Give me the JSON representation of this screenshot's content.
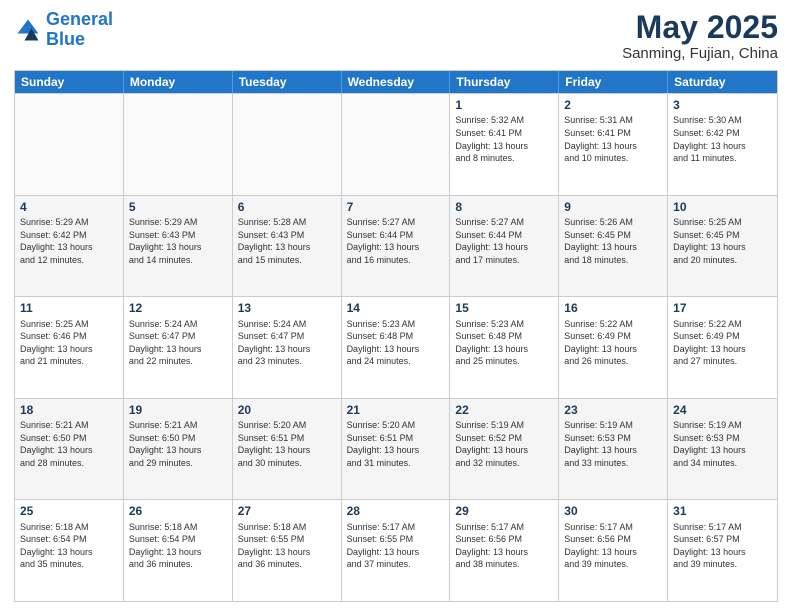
{
  "header": {
    "logo_line1": "General",
    "logo_line2": "Blue",
    "month": "May 2025",
    "location": "Sanming, Fujian, China"
  },
  "weekdays": [
    "Sunday",
    "Monday",
    "Tuesday",
    "Wednesday",
    "Thursday",
    "Friday",
    "Saturday"
  ],
  "rows": [
    [
      {
        "day": "",
        "info": "",
        "empty": true
      },
      {
        "day": "",
        "info": "",
        "empty": true
      },
      {
        "day": "",
        "info": "",
        "empty": true
      },
      {
        "day": "",
        "info": "",
        "empty": true
      },
      {
        "day": "1",
        "info": "Sunrise: 5:32 AM\nSunset: 6:41 PM\nDaylight: 13 hours\nand 8 minutes."
      },
      {
        "day": "2",
        "info": "Sunrise: 5:31 AM\nSunset: 6:41 PM\nDaylight: 13 hours\nand 10 minutes."
      },
      {
        "day": "3",
        "info": "Sunrise: 5:30 AM\nSunset: 6:42 PM\nDaylight: 13 hours\nand 11 minutes."
      }
    ],
    [
      {
        "day": "4",
        "info": "Sunrise: 5:29 AM\nSunset: 6:42 PM\nDaylight: 13 hours\nand 12 minutes."
      },
      {
        "day": "5",
        "info": "Sunrise: 5:29 AM\nSunset: 6:43 PM\nDaylight: 13 hours\nand 14 minutes."
      },
      {
        "day": "6",
        "info": "Sunrise: 5:28 AM\nSunset: 6:43 PM\nDaylight: 13 hours\nand 15 minutes."
      },
      {
        "day": "7",
        "info": "Sunrise: 5:27 AM\nSunset: 6:44 PM\nDaylight: 13 hours\nand 16 minutes."
      },
      {
        "day": "8",
        "info": "Sunrise: 5:27 AM\nSunset: 6:44 PM\nDaylight: 13 hours\nand 17 minutes."
      },
      {
        "day": "9",
        "info": "Sunrise: 5:26 AM\nSunset: 6:45 PM\nDaylight: 13 hours\nand 18 minutes."
      },
      {
        "day": "10",
        "info": "Sunrise: 5:25 AM\nSunset: 6:45 PM\nDaylight: 13 hours\nand 20 minutes."
      }
    ],
    [
      {
        "day": "11",
        "info": "Sunrise: 5:25 AM\nSunset: 6:46 PM\nDaylight: 13 hours\nand 21 minutes."
      },
      {
        "day": "12",
        "info": "Sunrise: 5:24 AM\nSunset: 6:47 PM\nDaylight: 13 hours\nand 22 minutes."
      },
      {
        "day": "13",
        "info": "Sunrise: 5:24 AM\nSunset: 6:47 PM\nDaylight: 13 hours\nand 23 minutes."
      },
      {
        "day": "14",
        "info": "Sunrise: 5:23 AM\nSunset: 6:48 PM\nDaylight: 13 hours\nand 24 minutes."
      },
      {
        "day": "15",
        "info": "Sunrise: 5:23 AM\nSunset: 6:48 PM\nDaylight: 13 hours\nand 25 minutes."
      },
      {
        "day": "16",
        "info": "Sunrise: 5:22 AM\nSunset: 6:49 PM\nDaylight: 13 hours\nand 26 minutes."
      },
      {
        "day": "17",
        "info": "Sunrise: 5:22 AM\nSunset: 6:49 PM\nDaylight: 13 hours\nand 27 minutes."
      }
    ],
    [
      {
        "day": "18",
        "info": "Sunrise: 5:21 AM\nSunset: 6:50 PM\nDaylight: 13 hours\nand 28 minutes."
      },
      {
        "day": "19",
        "info": "Sunrise: 5:21 AM\nSunset: 6:50 PM\nDaylight: 13 hours\nand 29 minutes."
      },
      {
        "day": "20",
        "info": "Sunrise: 5:20 AM\nSunset: 6:51 PM\nDaylight: 13 hours\nand 30 minutes."
      },
      {
        "day": "21",
        "info": "Sunrise: 5:20 AM\nSunset: 6:51 PM\nDaylight: 13 hours\nand 31 minutes."
      },
      {
        "day": "22",
        "info": "Sunrise: 5:19 AM\nSunset: 6:52 PM\nDaylight: 13 hours\nand 32 minutes."
      },
      {
        "day": "23",
        "info": "Sunrise: 5:19 AM\nSunset: 6:53 PM\nDaylight: 13 hours\nand 33 minutes."
      },
      {
        "day": "24",
        "info": "Sunrise: 5:19 AM\nSunset: 6:53 PM\nDaylight: 13 hours\nand 34 minutes."
      }
    ],
    [
      {
        "day": "25",
        "info": "Sunrise: 5:18 AM\nSunset: 6:54 PM\nDaylight: 13 hours\nand 35 minutes."
      },
      {
        "day": "26",
        "info": "Sunrise: 5:18 AM\nSunset: 6:54 PM\nDaylight: 13 hours\nand 36 minutes."
      },
      {
        "day": "27",
        "info": "Sunrise: 5:18 AM\nSunset: 6:55 PM\nDaylight: 13 hours\nand 36 minutes."
      },
      {
        "day": "28",
        "info": "Sunrise: 5:17 AM\nSunset: 6:55 PM\nDaylight: 13 hours\nand 37 minutes."
      },
      {
        "day": "29",
        "info": "Sunrise: 5:17 AM\nSunset: 6:56 PM\nDaylight: 13 hours\nand 38 minutes."
      },
      {
        "day": "30",
        "info": "Sunrise: 5:17 AM\nSunset: 6:56 PM\nDaylight: 13 hours\nand 39 minutes."
      },
      {
        "day": "31",
        "info": "Sunrise: 5:17 AM\nSunset: 6:57 PM\nDaylight: 13 hours\nand 39 minutes."
      }
    ]
  ]
}
